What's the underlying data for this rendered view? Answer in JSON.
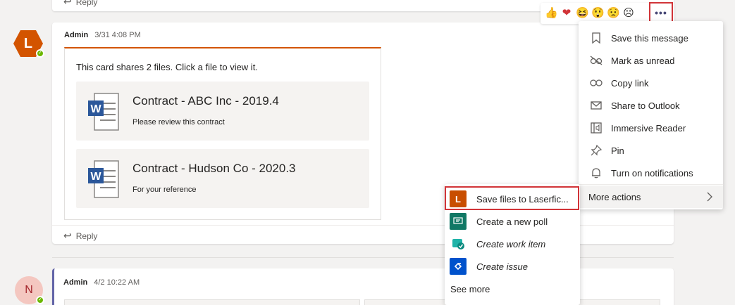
{
  "top_reply": {
    "label": "Reply"
  },
  "message1": {
    "avatar_letter": "L",
    "author": "Admin",
    "timestamp": "3/31 4:08 PM",
    "card_intro": "This card shares 2 files. Click a file to view it.",
    "files": [
      {
        "title": "Contract - ABC Inc - 2019.4",
        "subtitle": "Please review this contract",
        "icon": "word-file-icon"
      },
      {
        "title": "Contract - Hudson Co - 2020.3",
        "subtitle": "For your reference",
        "icon": "word-file-icon"
      }
    ],
    "reply_label": "Reply"
  },
  "message2": {
    "avatar_letter": "N",
    "author": "Admin",
    "timestamp": "4/2 10:22 AM"
  },
  "reactions": [
    "thumbs-up",
    "heart",
    "laugh",
    "surprised",
    "sad",
    "angry"
  ],
  "more_options_label": "•••",
  "context_menu": {
    "items": [
      {
        "label": "Save this message",
        "icon": "bookmark-icon"
      },
      {
        "label": "Mark as unread",
        "icon": "glasses-icon"
      },
      {
        "label": "Copy link",
        "icon": "link-icon"
      },
      {
        "label": "Share to Outlook",
        "icon": "mail-icon"
      },
      {
        "label": "Immersive Reader",
        "icon": "reader-icon"
      },
      {
        "label": "Pin",
        "icon": "pin-icon"
      },
      {
        "label": "Turn on notifications",
        "icon": "bell-icon"
      }
    ],
    "more_actions": "More actions"
  },
  "submenu": {
    "items": [
      {
        "label": "Save files to Laserfic...",
        "icon": "laserfiche-icon",
        "icon_letter": "L",
        "color": "#c84e00",
        "italic": false
      },
      {
        "label": "Create a new poll",
        "icon": "poll-icon",
        "color": "#117865",
        "italic": false
      },
      {
        "label": "Create work item",
        "icon": "work-item-icon",
        "color": "#1fb3a8",
        "italic": true
      },
      {
        "label": "Create issue",
        "icon": "jira-icon",
        "color": "#0052cc",
        "italic": true
      }
    ],
    "see_more": "See more"
  },
  "colors": {
    "accent": "#d35400",
    "highlight": "#d13438",
    "presence": "#6bb700"
  }
}
